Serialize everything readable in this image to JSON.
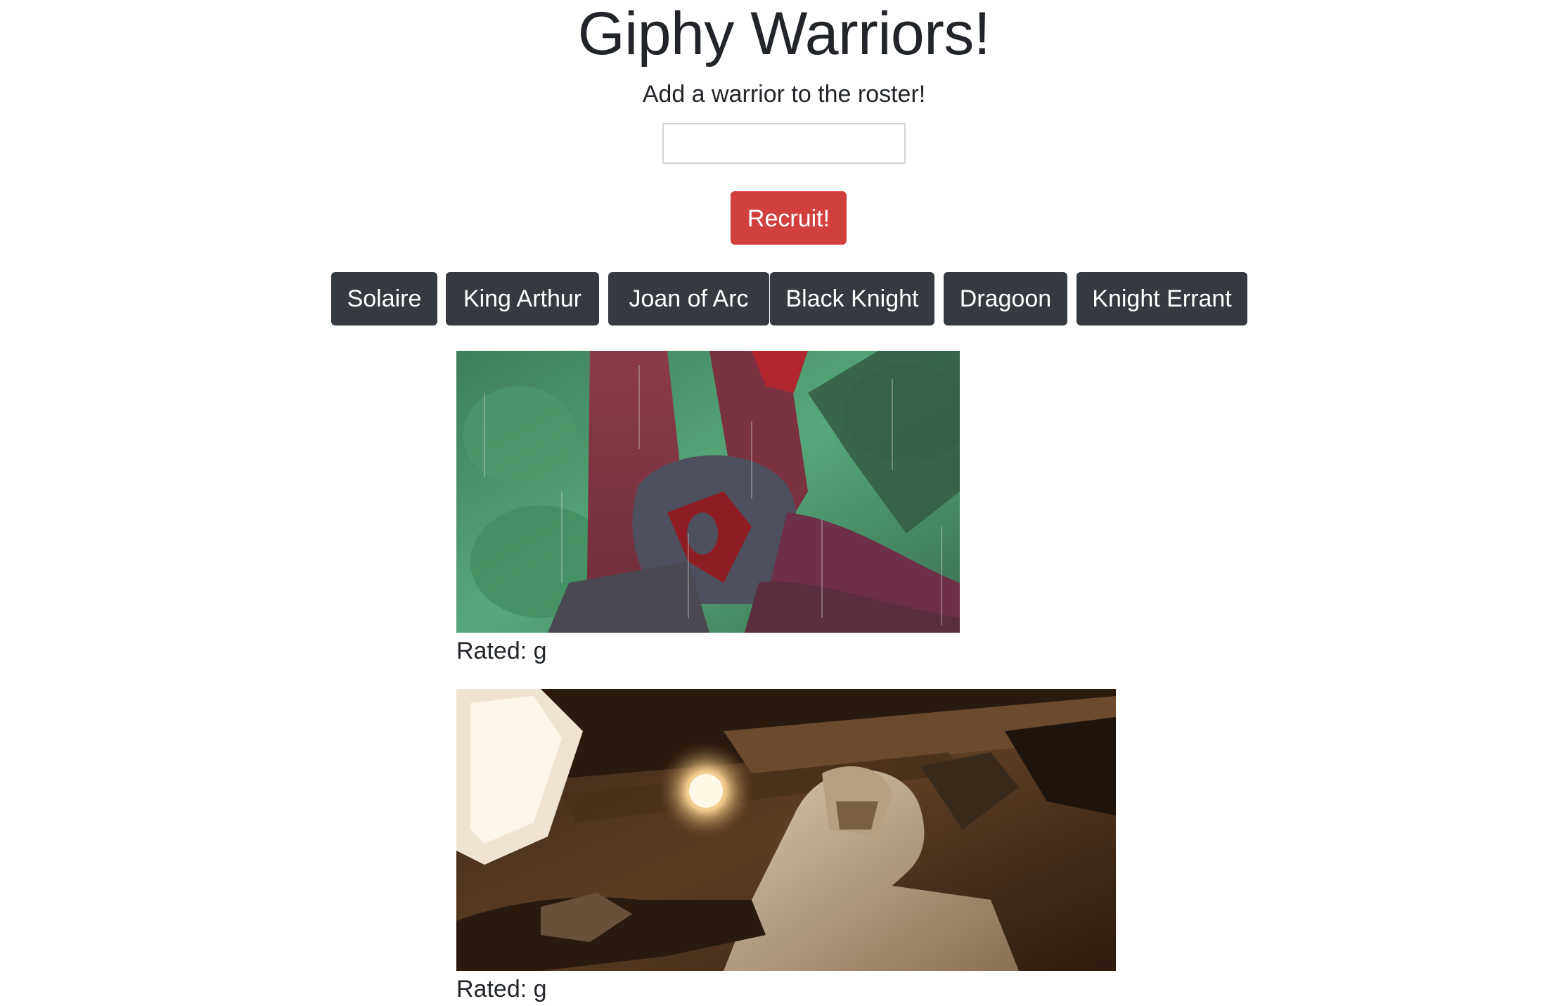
{
  "header": {
    "title": "Giphy Warriors!",
    "subtitle": "Add a warrior to the roster!"
  },
  "form": {
    "input_value": "",
    "recruit_label": "Recruit!"
  },
  "warriors": [
    {
      "label": "Solaire"
    },
    {
      "label": "King Arthur"
    },
    {
      "label": "Joan of Arc"
    },
    {
      "label": "Black Knight"
    },
    {
      "label": "Dragoon"
    },
    {
      "label": "Knight Errant"
    }
  ],
  "results": [
    {
      "rating_label": "Rated: g"
    },
    {
      "rating_label": "Rated: g"
    }
  ],
  "colors": {
    "primary_button": "#d1403f",
    "warrior_button": "#343a40",
    "text": "#212529"
  }
}
